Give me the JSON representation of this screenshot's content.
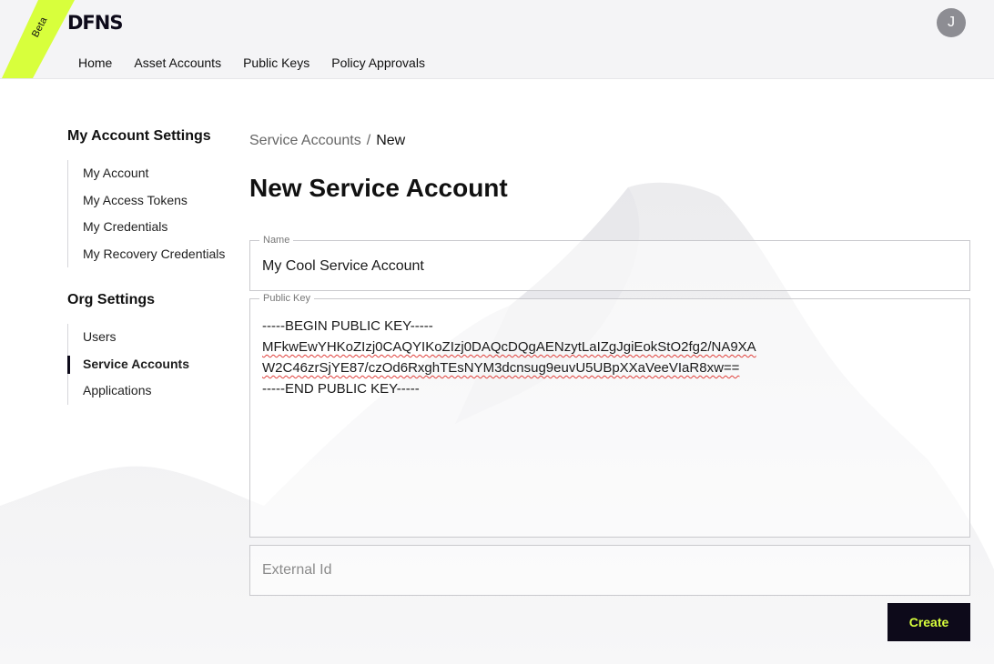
{
  "header": {
    "beta_label": "Beta",
    "logo_text": "DFNS",
    "avatar_initial": "J",
    "nav": [
      "Home",
      "Asset Accounts",
      "Public Keys",
      "Policy Approvals"
    ]
  },
  "sidebar": {
    "account_heading": "My Account Settings",
    "account_items": [
      "My Account",
      "My Access Tokens",
      "My Credentials",
      "My Recovery Credentials"
    ],
    "org_heading": "Org Settings",
    "org_items": [
      "Users",
      "Service Accounts",
      "Applications"
    ],
    "active_item": "Service Accounts"
  },
  "breadcrumb": {
    "parent": "Service Accounts",
    "separator": "/",
    "current": "New"
  },
  "page_title": "New Service Account",
  "form": {
    "name_label": "Name",
    "name_value": "My Cool Service Account",
    "public_key_label": "Public Key",
    "public_key_lines": [
      "-----BEGIN PUBLIC KEY-----",
      "MFkwEwYHKoZIzj0CAQYIKoZIzj0DAQcDQgAENzytLaIZgJgiEokStO2fg2/NA9XA",
      "W2C46zrSjYE87/czOd6RxghTEsNYM3dcnsug9euvU5UBpXXaVeeVIaR8xw==",
      "-----END PUBLIC KEY-----"
    ],
    "external_id_placeholder": "External Id",
    "submit_label": "Create"
  },
  "colors": {
    "accent_lime": "#d8ff3c",
    "dark": "#0d0a1a",
    "header_bg": "#f4f4f6"
  }
}
